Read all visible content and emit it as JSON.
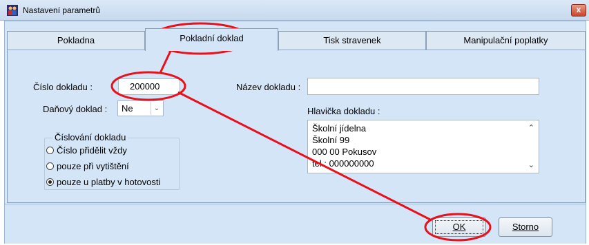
{
  "window": {
    "title": "Nastavení parametrů",
    "close_glyph": "x"
  },
  "tabs": [
    {
      "label": "Pokladna",
      "active": false
    },
    {
      "label": "Pokladní doklad",
      "active": true
    },
    {
      "label": "Tisk stravenek",
      "active": false
    },
    {
      "label": "Manipulační poplatky",
      "active": false
    }
  ],
  "form": {
    "cislo_dokladu_label": "Číslo dokladu :",
    "cislo_dokladu_value": "200000",
    "danovy_doklad_label": "Daňový doklad :",
    "danovy_doklad_value": "Ne",
    "nazev_dokladu_label": "Název dokladu :",
    "nazev_dokladu_value": "",
    "hlavicka_label": "Hlavička dokladu :",
    "hlavicka_lines": [
      "Školní jídelna",
      "Školní 99",
      "000 00 Pokusov",
      "tel.: 000000000"
    ]
  },
  "cislovani": {
    "title": "Číslování dokladu",
    "options": [
      {
        "label": "Číslo přidělit vždy",
        "checked": false
      },
      {
        "label": "pouze při vytištění",
        "checked": false
      },
      {
        "label": "pouze u platby v hotovosti",
        "checked": true
      }
    ]
  },
  "buttons": {
    "ok_label": "OK",
    "storno_label": "Storno"
  },
  "colors": {
    "annotation_red": "#e8101a",
    "panel_bg": "#d4e5f7"
  },
  "icons": {
    "app": "app-people-icon",
    "close": "close-icon",
    "dropdown": "chevron-down-icon",
    "scroll_up": "chevron-up-icon",
    "scroll_down": "chevron-down-icon"
  }
}
